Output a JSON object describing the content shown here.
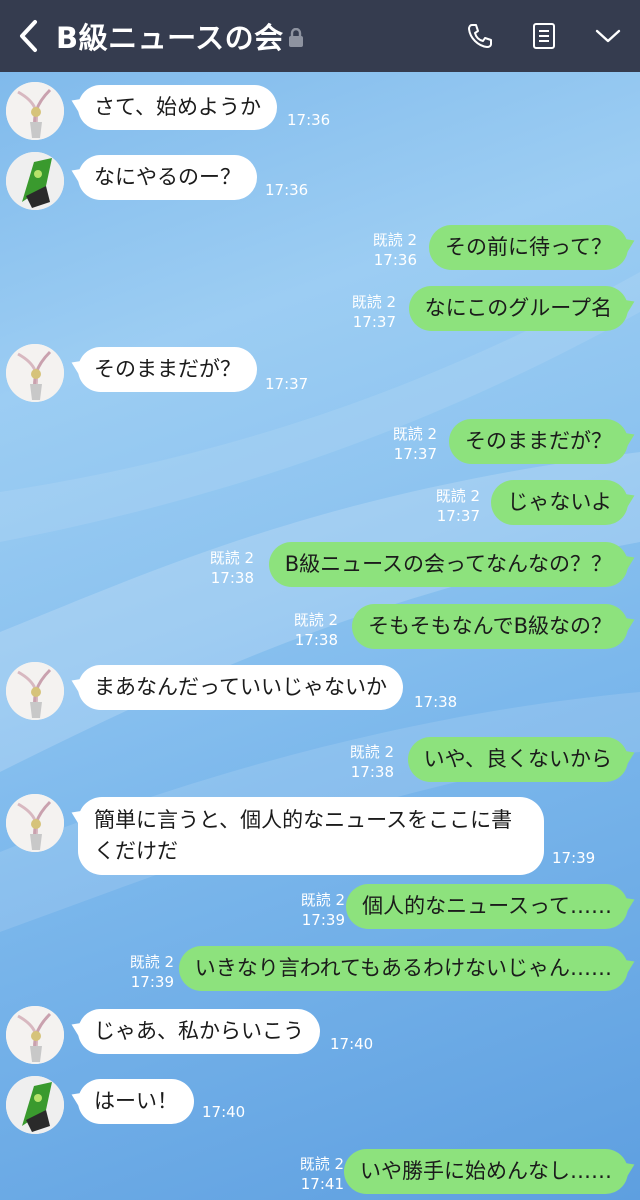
{
  "header": {
    "title": "B級ニュースの会",
    "bg_color": "#353c4f",
    "icons": [
      "back-icon",
      "lock-icon",
      "phone-icon",
      "notes-icon",
      "chevron-down-icon"
    ]
  },
  "colors": {
    "outgoing": "#8de27d",
    "incoming": "#ffffff"
  },
  "messages": [
    {
      "side": "in",
      "avatar": "white-character",
      "text": "さて、始めようか",
      "time": "17:36"
    },
    {
      "side": "in",
      "avatar": "green-character",
      "text": "なにやるのー？",
      "time": "17:36"
    },
    {
      "side": "out",
      "text": "その前に待って？",
      "read": "既読 2",
      "time": "17:36"
    },
    {
      "side": "out",
      "text": "なにこのグループ名",
      "read": "既読 2",
      "time": "17:37"
    },
    {
      "side": "in",
      "avatar": "white-character",
      "text": "そのままだが？",
      "time": "17:37"
    },
    {
      "side": "out",
      "text": "そのままだが？",
      "read": "既読 2",
      "time": "17:37"
    },
    {
      "side": "out",
      "text": "じゃないよ",
      "read": "既読 2",
      "time": "17:37"
    },
    {
      "side": "out",
      "text": "B級ニュースの会ってなんなの？？",
      "read": "既読 2",
      "time": "17:38"
    },
    {
      "side": "out",
      "text": "そもそもなんでB級なの？",
      "read": "既読 2",
      "time": "17:38"
    },
    {
      "side": "in",
      "avatar": "white-character",
      "text": "まあなんだっていいじゃないか",
      "time": "17:38"
    },
    {
      "side": "out",
      "text": "いや、良くないから",
      "read": "既読 2",
      "time": "17:38"
    },
    {
      "side": "in",
      "avatar": "white-character",
      "text": "簡単に言うと、個人的なニュースをここに書",
      "text2": "くだけだ",
      "time": "17:39"
    },
    {
      "side": "out",
      "text": "個人的なニュースって……",
      "read": "既読 2",
      "time": "17:39"
    },
    {
      "side": "out",
      "text": "いきなり言われてもあるわけないじゃん……",
      "read": "既読 2",
      "time": "17:39"
    },
    {
      "side": "in",
      "avatar": "white-character",
      "text": "じゃあ、私からいこう",
      "time": "17:40"
    },
    {
      "side": "in",
      "avatar": "green-character",
      "text": "はーい！",
      "time": "17:40"
    },
    {
      "side": "out",
      "text": "いや勝手に始めんなし……",
      "read": "既読 2",
      "time": "17:41"
    }
  ]
}
